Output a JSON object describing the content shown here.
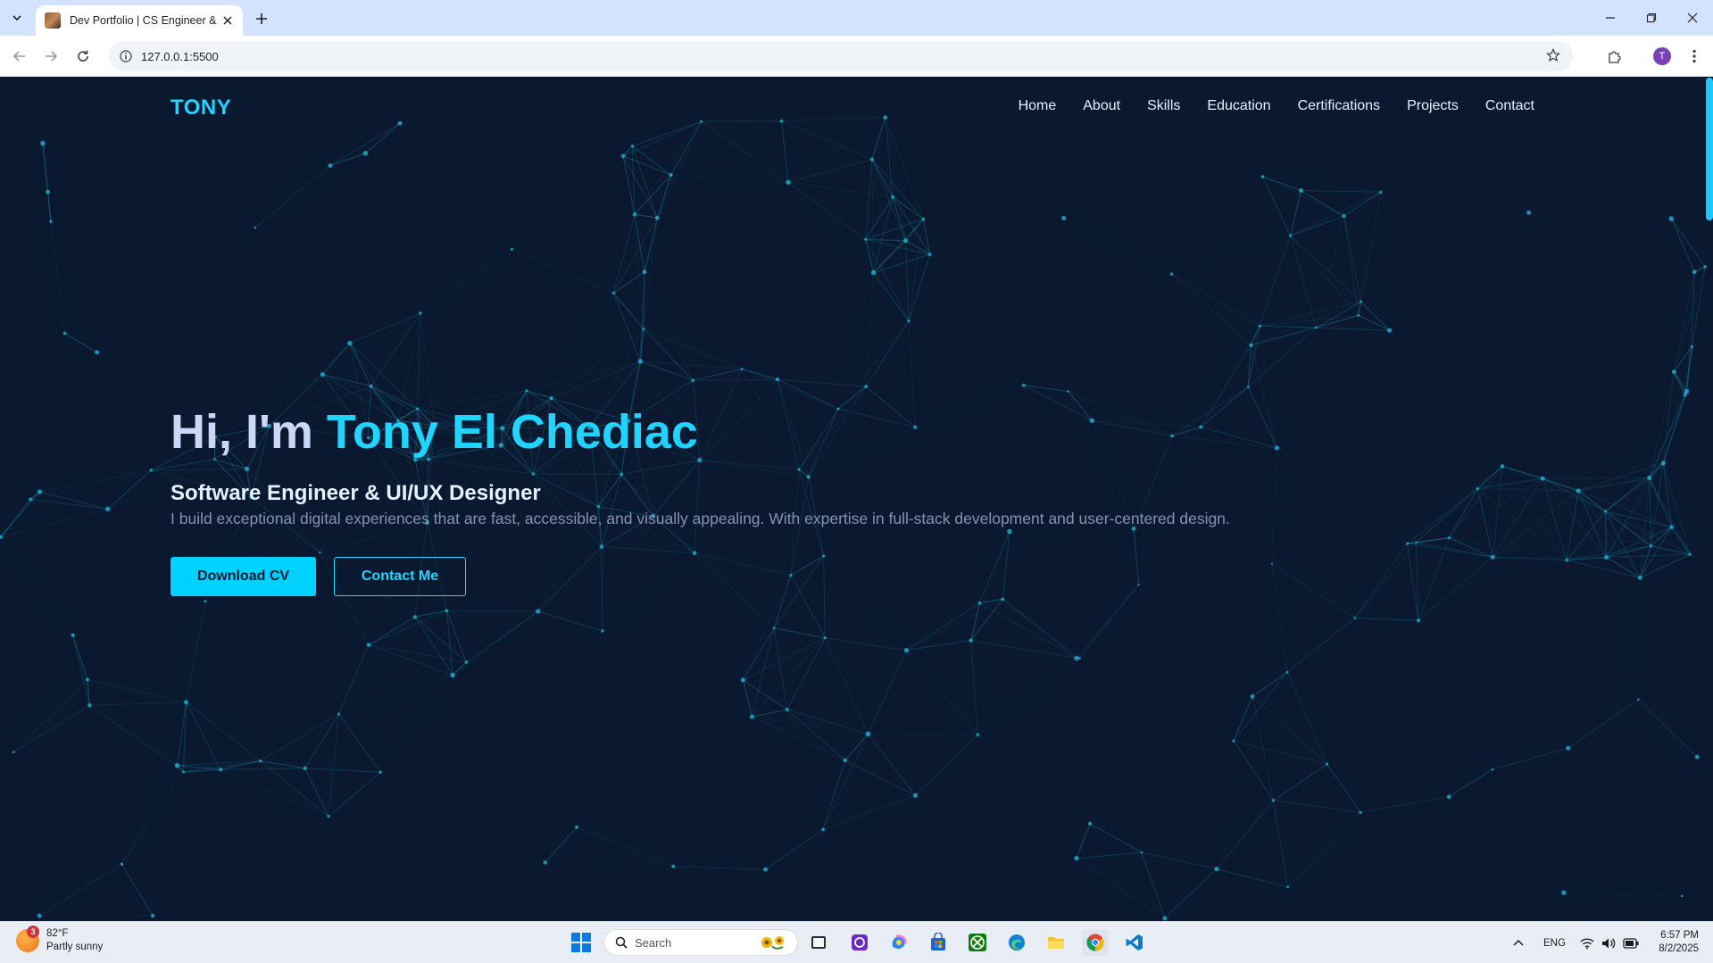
{
  "browser": {
    "tab_title": "Dev Portfolio | CS Engineer & U",
    "url": "127.0.0.1:5500",
    "profile_initial": "T"
  },
  "site": {
    "logo": "TONY",
    "nav": [
      "Home",
      "About",
      "Skills",
      "Education",
      "Certifications",
      "Projects",
      "Contact"
    ],
    "hero": {
      "greeting": "Hi, I'm ",
      "name": "Tony El Chediac",
      "subtitle": "Software Engineer & UI/UX Designer",
      "description": "I build exceptional digital experiences that are fast, accessible, and visually appealing. With expertise in full-stack development and user-centered design.",
      "primary_button": "Download CV",
      "secondary_button": "Contact Me"
    },
    "colors": {
      "background": "#0a192f",
      "accent": "#21d4fd",
      "text_light": "#ccd6f6",
      "text_muted": "#8892b0"
    }
  },
  "taskbar": {
    "weather_badge": "3",
    "temperature": "82°F",
    "condition": "Partly sunny",
    "search_placeholder": "Search",
    "language": "ENG",
    "time": "6:57 PM",
    "date": "8/2/2025",
    "apps": [
      "file-explorer-icon",
      "copilot-icon",
      "store-icon",
      "xbox-icon",
      "edge-icon",
      "folder-icon",
      "chrome-icon",
      "vscode-icon"
    ]
  }
}
